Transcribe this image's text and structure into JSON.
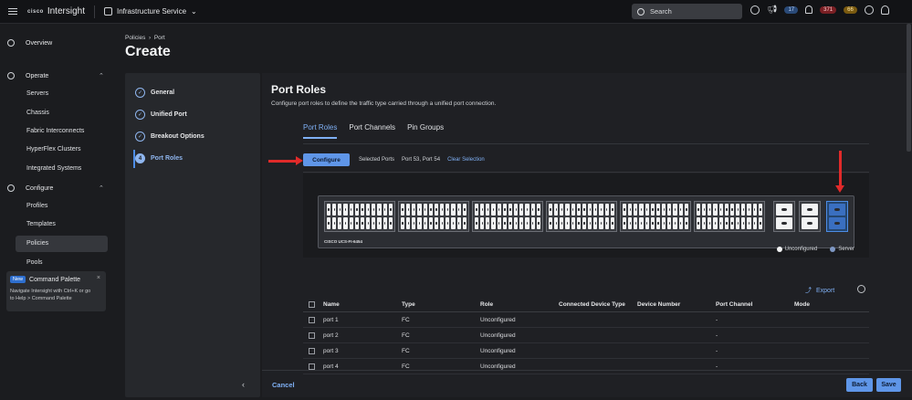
{
  "topbar": {
    "brand_small": "cisco",
    "brand": "Intersight",
    "service": "Infrastructure Service",
    "search_label": "Search",
    "announcements_count": "17",
    "critical_count": "371",
    "warning_count": "66"
  },
  "sidebar": {
    "overview": "Overview",
    "operate": "Operate",
    "operate_items": [
      "Servers",
      "Chassis",
      "Fabric Interconnects",
      "HyperFlex Clusters",
      "Integrated Systems"
    ],
    "configure": "Configure",
    "configure_items": [
      "Profiles",
      "Templates",
      "Policies",
      "Pools"
    ],
    "palette": {
      "badge": "New",
      "title": "Command Palette",
      "line1": "Navigate Intersight with Ctrl+K or go",
      "line2": "to Help > Command Palette"
    }
  },
  "breadcrumb": {
    "parent": "Policies",
    "current": "Port"
  },
  "page_title": "Create",
  "wizard": {
    "steps": [
      {
        "label": "General",
        "num": ""
      },
      {
        "label": "Unified Port",
        "num": ""
      },
      {
        "label": "Breakout Options",
        "num": ""
      },
      {
        "label": "Port Roles",
        "num": "4"
      }
    ]
  },
  "main": {
    "title": "Port Roles",
    "description": "Configure port roles to define the traffic type carried through a unified port connection.",
    "tabs": [
      "Port Roles",
      "Port Channels",
      "Pin Groups"
    ],
    "configure_button": "Configure",
    "selected_ports_label": "Selected Ports",
    "selected_ports_value": "Port 53, Port 54",
    "clear_selection": "Clear Selection",
    "fi_model": "CISCO UCS-FI-6454",
    "legend": [
      "Unconfigured",
      "Server"
    ],
    "export": "Export",
    "table": {
      "headers": [
        "Name",
        "Type",
        "Role",
        "Connected Device Type",
        "Device Number",
        "Port Channel",
        "Mode"
      ],
      "rows": [
        [
          "port 1",
          "FC",
          "Unconfigured",
          "",
          "",
          "-",
          ""
        ],
        [
          "port 2",
          "FC",
          "Unconfigured",
          "",
          "",
          "-",
          ""
        ],
        [
          "port 3",
          "FC",
          "Unconfigured",
          "",
          "",
          "-",
          ""
        ],
        [
          "port 4",
          "FC",
          "Unconfigured",
          "",
          "",
          "-",
          ""
        ]
      ]
    },
    "cancel": "Cancel",
    "back": "Back",
    "save": "Save"
  },
  "colors": {
    "accent": "#5f96e8",
    "link": "#7fb0f5",
    "annotation_arrow": "#e02a2a"
  }
}
